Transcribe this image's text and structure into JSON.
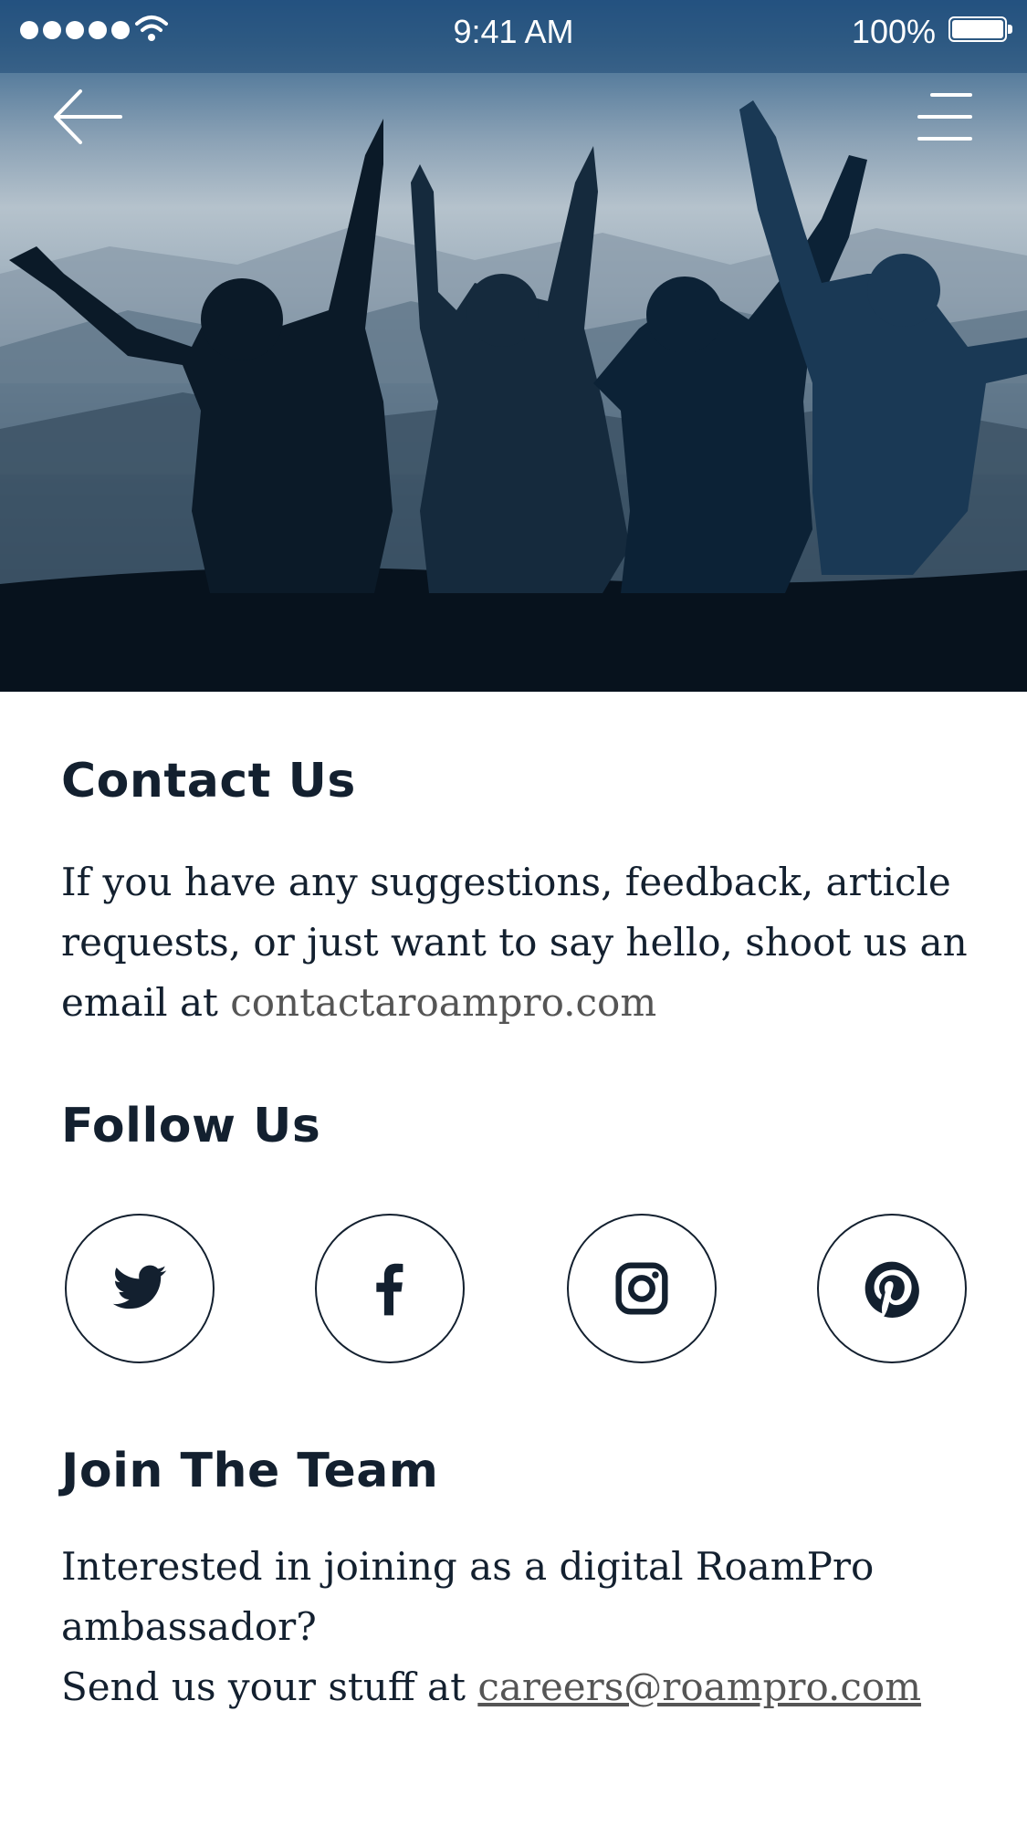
{
  "status_bar": {
    "time": "9:41 AM",
    "battery": "100%",
    "icons": [
      "signal-dots-icon",
      "wifi-icon",
      "battery-icon"
    ]
  },
  "nav": {
    "icons": [
      "arrow-left-icon",
      "menu-icon"
    ]
  },
  "contact": {
    "title": "Contact Us",
    "text": "If you have any suggestions, feedback, article requests, or just want to say hello, shoot us an email at ",
    "email": "contactaroampro.com"
  },
  "follow": {
    "title": "Follow Us",
    "icons": [
      "twitter-icon",
      "facebook-icon",
      "instagram-icon",
      "pinterest-icon"
    ]
  },
  "join": {
    "title": "Join The Team",
    "line1": "Interested in joining as a digital RoamPro ambassador?",
    "line2": "Send us your stuff at ",
    "email": "careers@roampro.com"
  },
  "colors": {
    "text": "#13202f",
    "link": "#555555",
    "hero_top": "#2a5a8c",
    "hero_bottom": "#0d2236"
  }
}
